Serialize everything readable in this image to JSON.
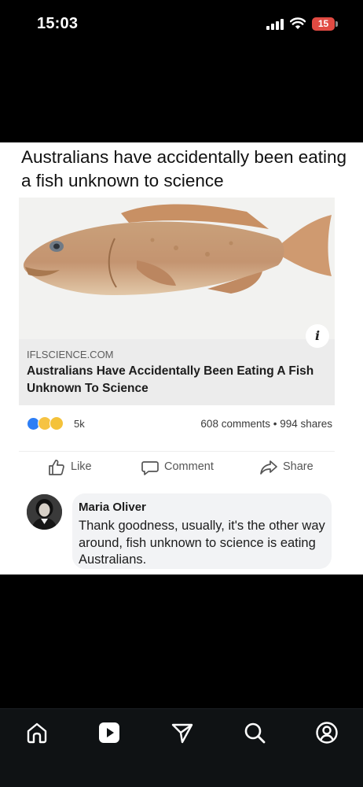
{
  "status_bar": {
    "time": "15:03",
    "battery_level": "15",
    "battery_color": "#e14a42",
    "icons": [
      "signal-icon",
      "wifi-icon",
      "battery-icon"
    ]
  },
  "post": {
    "meme_title": "Australians have accidentally been eating a fish unknown to science",
    "link_preview": {
      "image": "fish-photo",
      "domain": "IFLSCIENCE.COM",
      "headline": "Australians Have Accidentally Been Eating A Fish Unknown To Science"
    },
    "reactions": {
      "types": [
        "like-reaction-icon",
        "haha-reaction-icon",
        "wow-reaction-icon"
      ],
      "count": "5k"
    },
    "engagement": "608 comments • 994 shares",
    "actions": {
      "like": "Like",
      "comment": "Comment",
      "share": "Share"
    },
    "comment": {
      "author": "Maria Oliver",
      "text": "Thank goodness, usually, it's the other way around, fish unknown to science is eating Australians."
    }
  },
  "bottom_nav": {
    "items": [
      "home-icon",
      "video-icon",
      "send-icon",
      "search-icon",
      "profile-icon"
    ]
  },
  "colors": {
    "background": "#000000",
    "like_blue": "#2d7ef5",
    "nav_bg": "#0f1214"
  }
}
